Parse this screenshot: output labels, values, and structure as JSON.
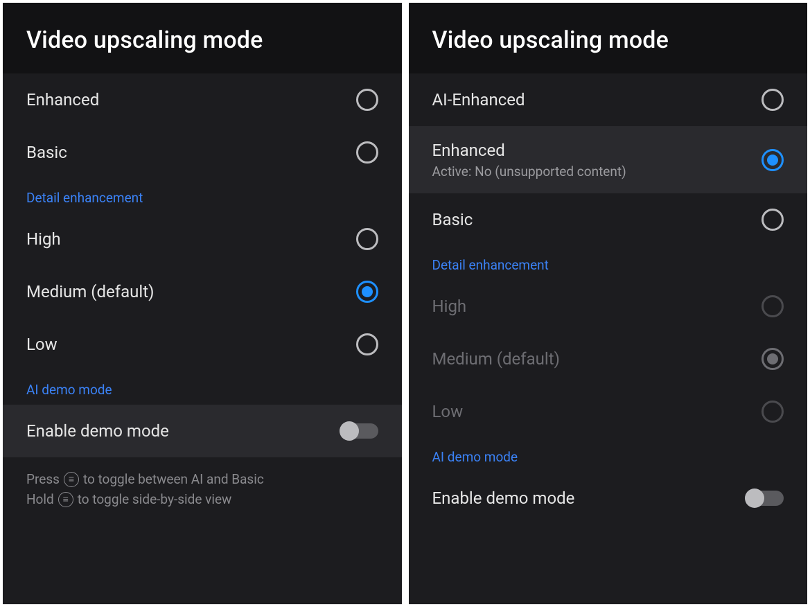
{
  "left": {
    "title": "Video upscaling mode",
    "options": [
      {
        "label": "Enhanced",
        "selected": false
      },
      {
        "label": "Basic",
        "selected": false
      }
    ],
    "detail_header": "Detail enhancement",
    "detail_options": [
      {
        "label": "High",
        "selected": false
      },
      {
        "label": "Medium (default)",
        "selected": true
      },
      {
        "label": "Low",
        "selected": false
      }
    ],
    "demo_header": "AI demo mode",
    "demo_toggle_label": "Enable demo mode",
    "demo_toggle_on": false,
    "help": {
      "press_pre": "Press",
      "press_post": "to toggle between AI and Basic",
      "hold_pre": "Hold",
      "hold_post": "to toggle side-by-side view",
      "glyph": "≡"
    }
  },
  "right": {
    "title": "Video upscaling mode",
    "options": [
      {
        "label": "AI-Enhanced",
        "subtitle": "",
        "selected": false
      },
      {
        "label": "Enhanced",
        "subtitle": "Active: No (unsupported content)",
        "selected": true
      },
      {
        "label": "Basic",
        "subtitle": "",
        "selected": false
      }
    ],
    "detail_header": "Detail enhancement",
    "detail_options": [
      {
        "label": "High",
        "selected": false
      },
      {
        "label": "Medium (default)",
        "selected": true
      },
      {
        "label": "Low",
        "selected": false
      }
    ],
    "detail_disabled": true,
    "demo_header": "AI demo mode",
    "demo_toggle_label": "Enable demo mode",
    "demo_toggle_on": false
  }
}
